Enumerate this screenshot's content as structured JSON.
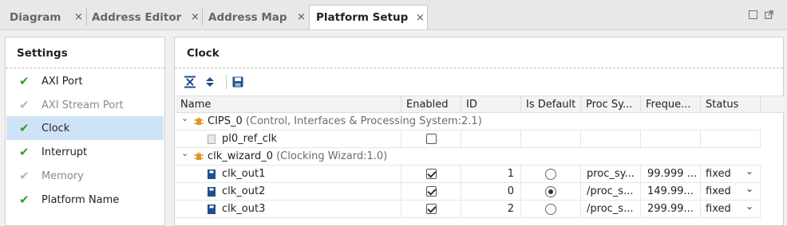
{
  "tabs": [
    {
      "label": "Diagram"
    },
    {
      "label": "Address Editor"
    },
    {
      "label": "Address Map"
    },
    {
      "label": "Platform Setup"
    }
  ],
  "tab_close_glyph": "×",
  "settings": {
    "title": "Settings",
    "items": [
      {
        "label": "AXI Port",
        "icon": "check-icon"
      },
      {
        "label": "AXI Stream Port",
        "icon": "check-icon"
      },
      {
        "label": "Clock",
        "icon": "check-icon"
      },
      {
        "label": "Interrupt",
        "icon": "check-icon"
      },
      {
        "label": "Memory",
        "icon": "check-icon"
      },
      {
        "label": "Platform Name",
        "icon": "check-icon"
      }
    ],
    "check_glyph": "✔"
  },
  "clock": {
    "title": "Clock",
    "columns": [
      "Name",
      "Enabled",
      "ID",
      "Is Default",
      "Proc Sy...",
      "Freque...",
      "Status"
    ],
    "groups": [
      {
        "name": "CIPS_0",
        "desc": "(Control, Interfaces & Processing System:2.1)",
        "rows": [
          {
            "name": "pl0_ref_clk",
            "enabled": false,
            "id": "",
            "is_default": null,
            "proc": "",
            "freq": "",
            "status": ""
          }
        ]
      },
      {
        "name": "clk_wizard_0",
        "desc": "(Clocking Wizard:1.0)",
        "rows": [
          {
            "name": "clk_out1",
            "enabled": true,
            "id": "1",
            "is_default": false,
            "proc": "proc_sy...",
            "freq": "99.999 ...",
            "status": "fixed"
          },
          {
            "name": "clk_out2",
            "enabled": true,
            "id": "0",
            "is_default": true,
            "proc": "/proc_s...",
            "freq": "149.99...",
            "status": "fixed"
          },
          {
            "name": "clk_out3",
            "enabled": true,
            "id": "2",
            "is_default": false,
            "proc": "/proc_s...",
            "freq": "299.99...",
            "status": "fixed"
          }
        ]
      }
    ]
  },
  "glyphs": {
    "expanded": "⌄",
    "dropdown": "⌄"
  },
  "colors": {
    "accent_check": "#2aa12a",
    "selected_row": "#cfe3f7"
  }
}
